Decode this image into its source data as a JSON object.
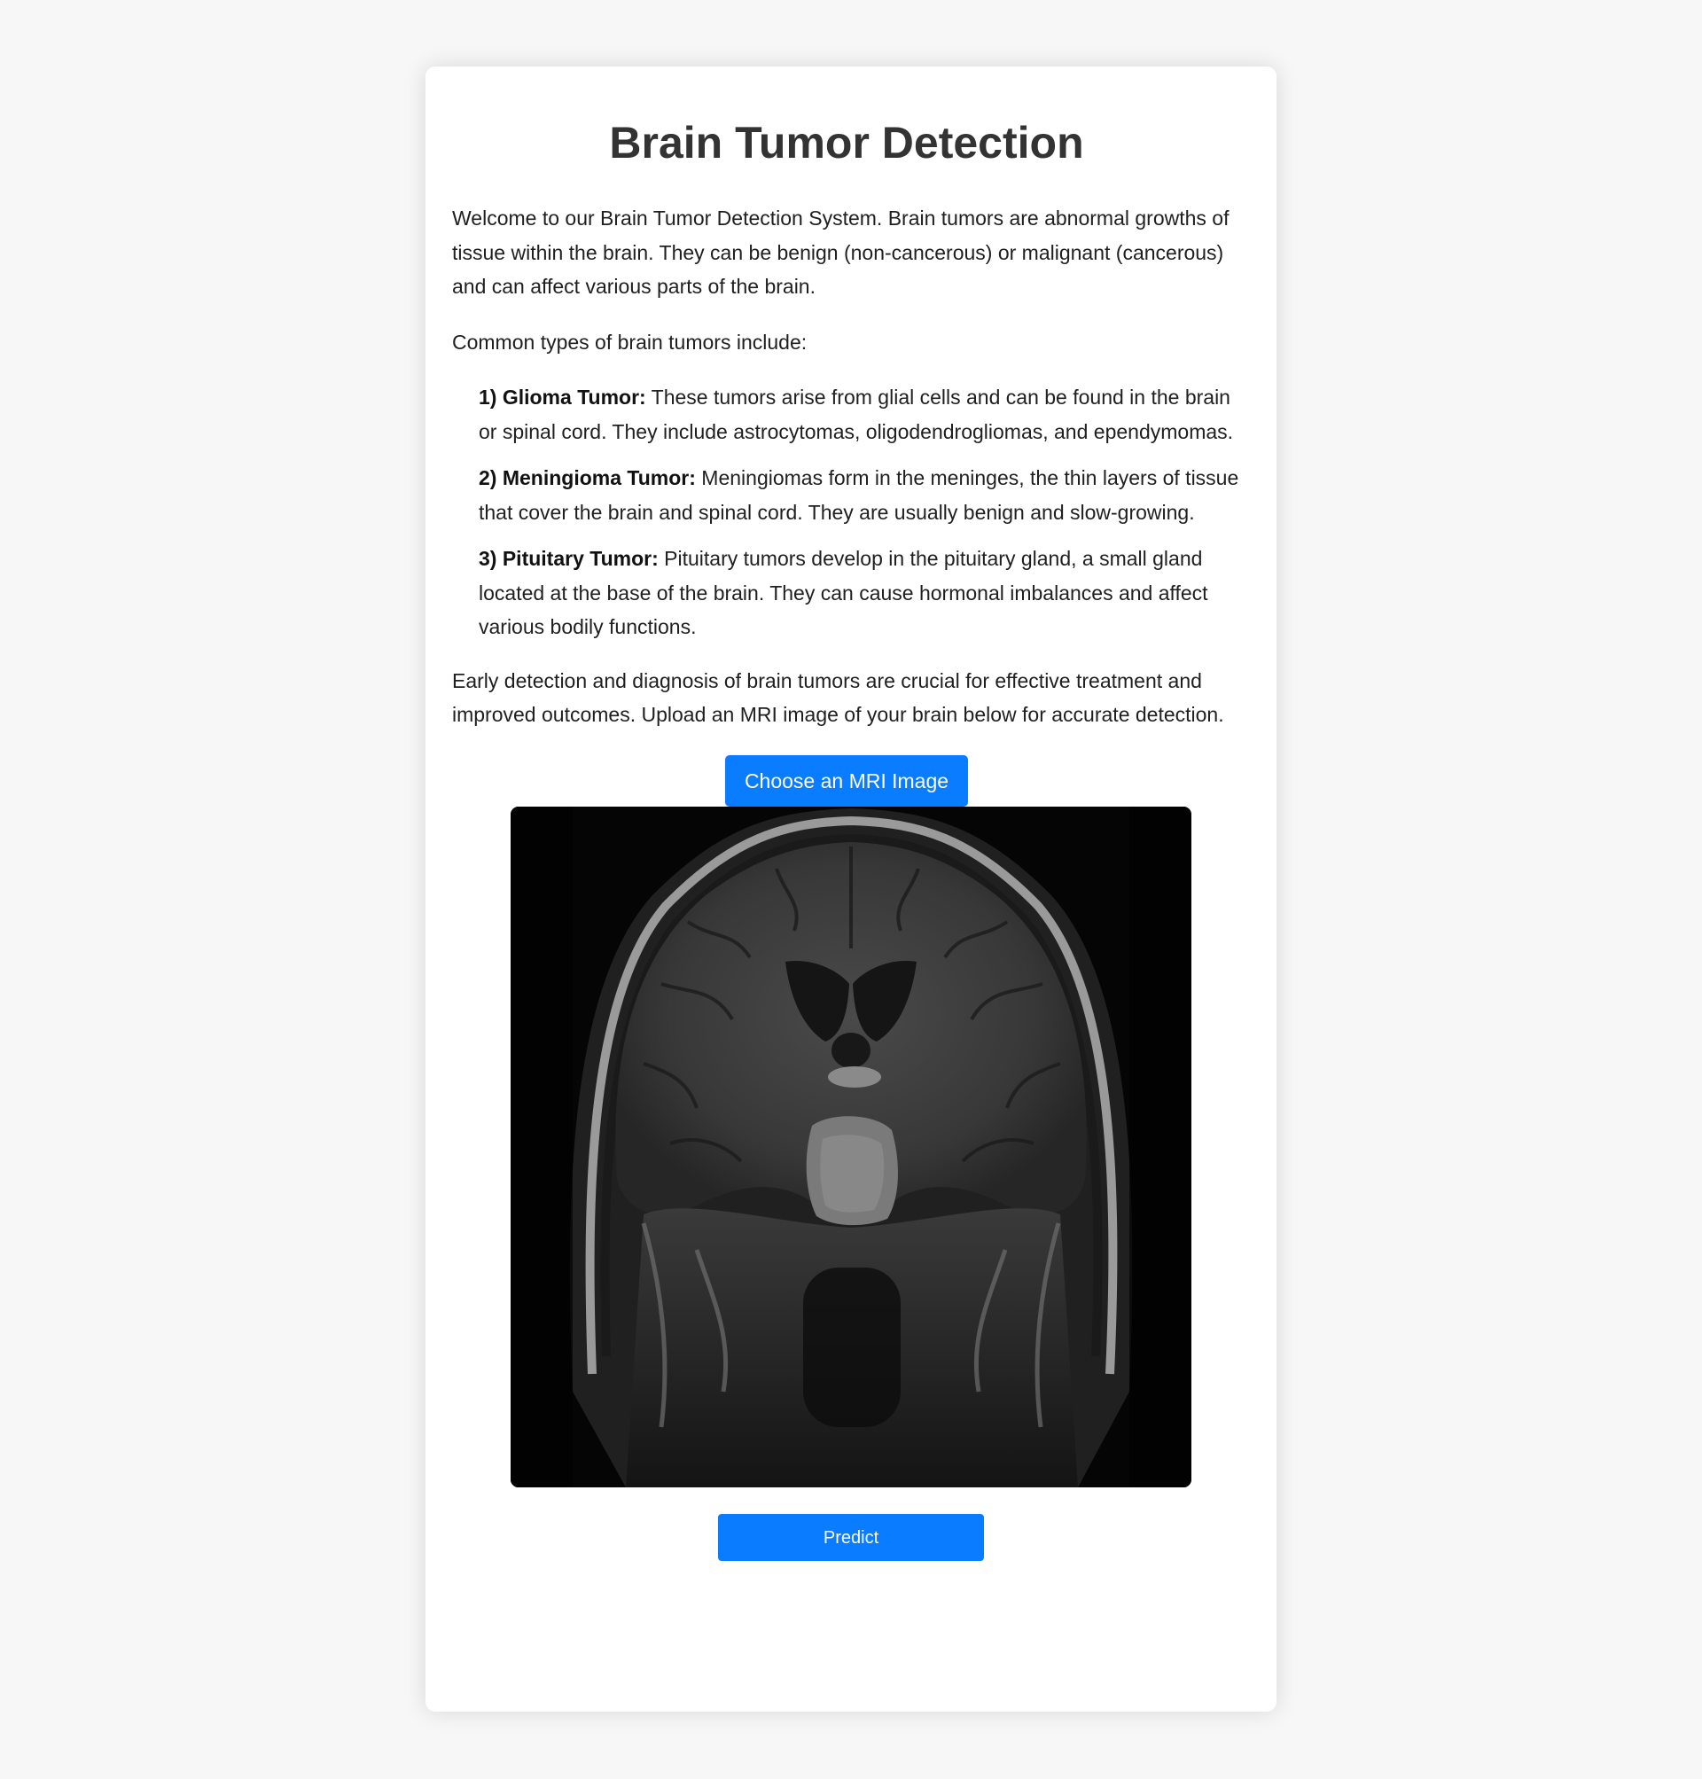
{
  "page": {
    "title": "Brain Tumor Detection",
    "intro": "Welcome to our Brain Tumor Detection System. Brain tumors are abnormal growths of tissue within the brain. They can be benign (non-cancerous) or malignant (cancerous) and can affect various parts of the brain.",
    "types_intro": "Common types of brain tumors include:",
    "tumor_types": [
      {
        "name": "1) Glioma Tumor:",
        "description": " These tumors arise from glial cells and can be found in the brain or spinal cord. They include astrocytomas, oligodendrogliomas, and ependymomas."
      },
      {
        "name": "2) Meningioma Tumor:",
        "description": " Meningiomas form in the meninges, the thin layers of tissue that cover the brain and spinal cord. They are usually benign and slow-growing."
      },
      {
        "name": "3) Pituitary Tumor:",
        "description": " Pituitary tumors develop in the pituitary gland, a small gland located at the base of the brain. They can cause hormonal imbalances and affect various bodily functions."
      }
    ],
    "outro": "Early detection and diagnosis of brain tumors are crucial for effective treatment and improved outcomes. Upload an MRI image of your brain below for accurate detection."
  },
  "upload": {
    "choose_label": "Choose an MRI Image",
    "predict_label": "Predict"
  },
  "colors": {
    "accent": "#0a7cff",
    "background": "#f7f7f7",
    "card": "#ffffff"
  }
}
